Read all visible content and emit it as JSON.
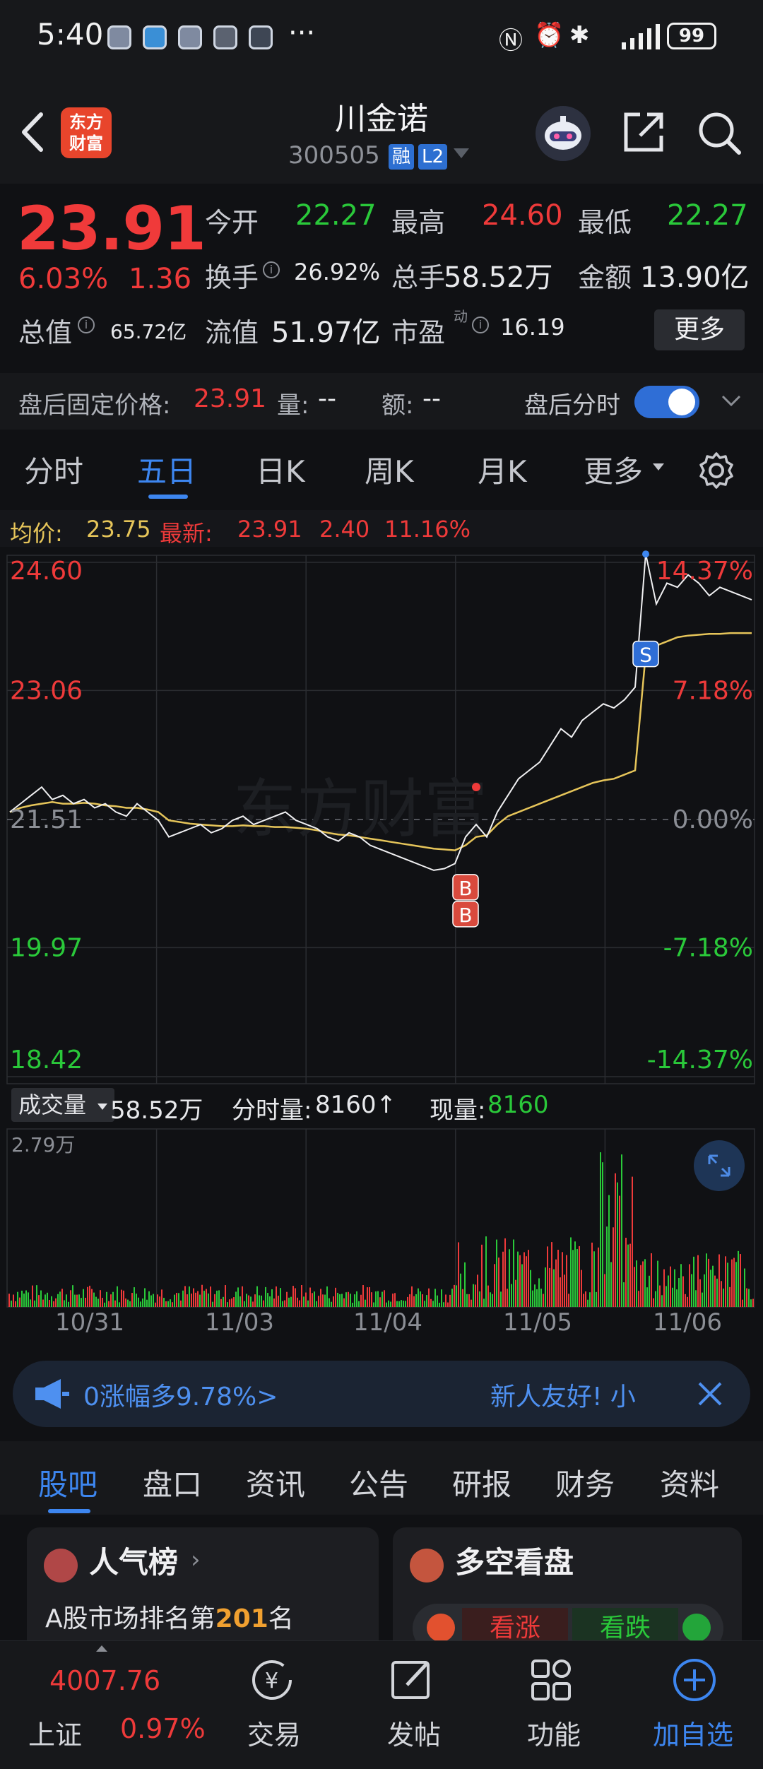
{
  "status_bar": {
    "time": "5:40",
    "more": "···",
    "battery": "99"
  },
  "header": {
    "name": "川金诺",
    "code": "300505",
    "badge_margin": "融",
    "badge_l2": "L2",
    "logo_line1": "东方",
    "logo_line2": "财富"
  },
  "quote": {
    "last": "23.91",
    "pct": "6.03%",
    "change": "1.36",
    "fields": {
      "open_label": "今开",
      "open": "22.27",
      "high_label": "最高",
      "high": "24.60",
      "low_label": "最低",
      "low": "22.27",
      "turnover_label": "换手",
      "turnover": "26.92%",
      "volume_label": "总手",
      "volume": "58.52万",
      "amount_label": "金额",
      "amount": "13.90亿",
      "mktcap_label": "总值",
      "mktcap": "65.72亿",
      "float_label": "流值",
      "float": "51.97亿",
      "pe_label": "市盈",
      "pe_sup": "动",
      "pe": "16.19"
    },
    "more_label": "更多"
  },
  "after_hours": {
    "fixed_label": "盘后固定价格:",
    "fixed_price": "23.91",
    "vol_label": "量:",
    "vol": "--",
    "amt_label": "额:",
    "amt": "--",
    "toggle_label": "盘后分时",
    "toggle_on": true
  },
  "chart_tabs": [
    "分时",
    "五日",
    "日K",
    "周K",
    "月K",
    "更多"
  ],
  "chart_tabs_active": 1,
  "summary": {
    "avg_label": "均价:",
    "avg": "23.75",
    "latest_label": "最新:",
    "latest": "23.91",
    "chg": "2.40",
    "pct": "11.16%"
  },
  "chart_data": {
    "type": "line",
    "title": "",
    "xlabel": "",
    "ylabel": "",
    "categories": [
      "10/31",
      "11/03",
      "11/04",
      "11/05",
      "11/06"
    ],
    "y_ticks_left": [
      "24.60",
      "23.06",
      "21.51",
      "19.97",
      "18.42"
    ],
    "y_ticks_right": [
      "14.37%",
      "7.18%",
      "0.00%",
      "-7.18%",
      "-14.37%"
    ],
    "ylim": [
      18.42,
      24.6
    ],
    "base": 21.51,
    "series": [
      {
        "values": [
          21.6,
          21.7,
          21.8,
          21.9,
          21.75,
          21.8,
          21.7,
          21.75,
          21.65,
          21.7,
          21.6,
          21.55,
          21.7,
          21.6,
          21.5,
          21.3,
          21.35,
          21.4,
          21.45,
          21.35,
          21.4,
          21.5,
          21.55,
          21.45,
          21.5,
          21.55,
          21.6,
          21.5,
          21.45,
          21.4,
          21.3,
          21.25,
          21.35,
          21.3,
          21.2,
          21.15,
          21.1,
          21.05,
          21.0,
          20.95,
          20.9,
          20.92,
          20.98,
          21.3,
          21.45,
          21.3,
          21.6,
          21.8,
          22.0,
          22.1,
          22.2,
          22.4,
          22.6,
          22.5,
          22.7,
          22.8,
          22.9,
          22.85,
          22.95,
          23.1,
          24.7,
          24.1,
          24.35,
          24.3,
          24.45,
          24.35,
          24.2,
          24.3,
          24.25,
          24.2,
          24.15
        ]
      },
      {
        "values": [
          21.6,
          21.65,
          21.68,
          21.7,
          21.72,
          21.7,
          21.7,
          21.71,
          21.7,
          21.68,
          21.67,
          21.65,
          21.65,
          21.63,
          21.6,
          21.5,
          21.48,
          21.46,
          21.45,
          21.44,
          21.43,
          21.43,
          21.44,
          21.43,
          21.43,
          21.42,
          21.42,
          21.41,
          21.4,
          21.38,
          21.35,
          21.33,
          21.32,
          21.3,
          21.28,
          21.26,
          21.24,
          21.22,
          21.2,
          21.18,
          21.16,
          21.15,
          21.14,
          21.2,
          21.3,
          21.32,
          21.45,
          21.55,
          21.6,
          21.65,
          21.7,
          21.75,
          21.8,
          21.85,
          21.9,
          21.95,
          21.98,
          22.0,
          22.05,
          22.1,
          23.5,
          23.6,
          23.65,
          23.7,
          23.72,
          23.73,
          23.74,
          23.74,
          23.75,
          23.75,
          23.75
        ]
      }
    ]
  },
  "trade_marks": [
    {
      "label": "B"
    },
    {
      "label": "B"
    },
    {
      "label": "S"
    }
  ],
  "volume": {
    "dd_label": "成交量",
    "total": "58.52万",
    "tick_label": "分时量:",
    "tick": "8160↑",
    "now_label": "现量:",
    "now": "8160",
    "ymax": "2.79万"
  },
  "banner": {
    "left": "0涨幅多9.78%>",
    "right": "新人友好! 小"
  },
  "content_tabs": [
    "股吧",
    "盘口",
    "资讯",
    "公告",
    "研报",
    "财务",
    "资料"
  ],
  "content_tabs_active": 0,
  "card_popular": {
    "title": "人气榜",
    "text_prefix": "A股市场排名第",
    "rank": "201",
    "text_suffix": "名"
  },
  "card_vs": {
    "title": "多空看盘",
    "bull": "看涨",
    "bear": "看跌"
  },
  "bottom_nav": {
    "index_value": "4007.76",
    "index_name": "上证",
    "index_pct": "0.97%",
    "trade": "交易",
    "post": "发帖",
    "func": "功能",
    "add": "加自选"
  },
  "colors": {
    "up": "#ee3a3a",
    "down": "#2ac93a",
    "accent": "#3d86f0",
    "avg_line": "#e6c55a"
  }
}
